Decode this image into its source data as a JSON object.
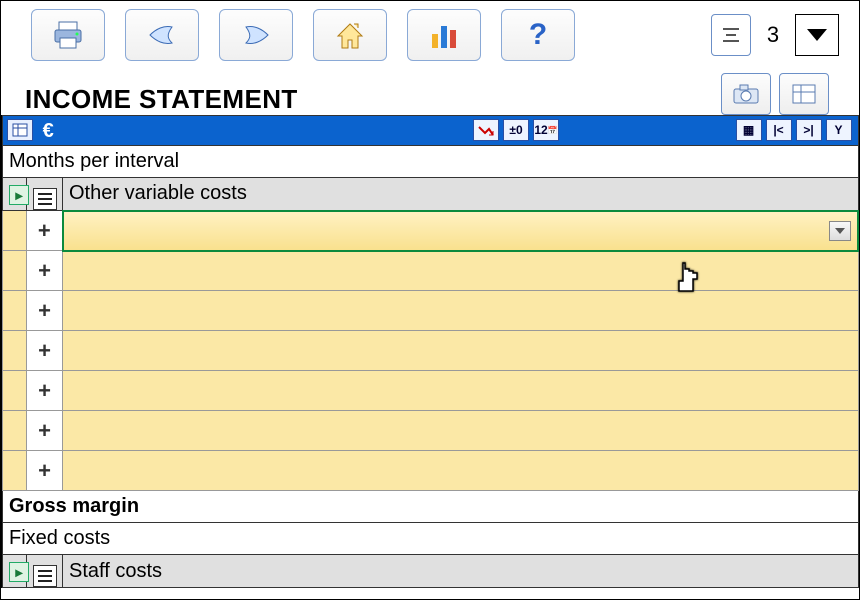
{
  "title": "INCOME STATEMENT",
  "currency": "€",
  "zoom": {
    "value": "3"
  },
  "rows": {
    "months": "Months per interval",
    "other_variable": "Other variable costs",
    "gross_margin": "Gross margin",
    "fixed_costs": "Fixed costs",
    "staff_costs": "Staff costs"
  },
  "blue_icons": {
    "trend": "↯",
    "decimals": "±0",
    "calendar": "12"
  },
  "nav_icons": {
    "grid": "▦",
    "first": "|<",
    "last": ">|",
    "tree": "Y"
  },
  "toolbar": {
    "print": "print-icon",
    "hand_left": "hand-left-icon",
    "hand_right": "hand-right-icon",
    "home": "home-icon",
    "chart": "chart-icon",
    "help": "?"
  },
  "plus": "+"
}
